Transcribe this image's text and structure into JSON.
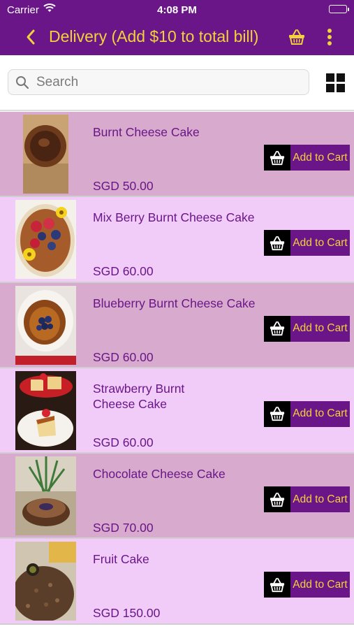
{
  "status_bar": {
    "carrier": "Carrier",
    "time": "4:08 PM"
  },
  "nav": {
    "title": "Delivery (Add $10 to total bill)"
  },
  "search": {
    "placeholder": "Search"
  },
  "products": [
    {
      "name": "Burnt Cheese Cake",
      "price": "SGD 50.00",
      "cart_label": "Add to Cart"
    },
    {
      "name": "Mix Berry Burnt Cheese Cake",
      "price": "SGD 60.00",
      "cart_label": "Add to Cart"
    },
    {
      "name": "Blueberry Burnt Cheese Cake",
      "price": "SGD 60.00",
      "cart_label": "Add to Cart"
    },
    {
      "name": "Strawberry Burnt Cheese Cake",
      "price": "SGD 60.00",
      "cart_label": "Add to Cart"
    },
    {
      "name": "Chocolate Cheese Cake",
      "price": "SGD 70.00",
      "cart_label": "Add to Cart"
    },
    {
      "name": "Fruit Cake",
      "price": "SGD 150.00",
      "cart_label": "Add to Cart"
    }
  ],
  "colors": {
    "header_bg": "#6a1688",
    "title_text": "#f2d13b",
    "row_dark": "#d8aacd",
    "row_light": "#f1ccf9",
    "cart_icon_bg": "#000000"
  },
  "icons": [
    "back-chevron-icon",
    "basket-icon",
    "more-vertical-icon",
    "search-icon",
    "grid-view-icon",
    "cart-basket-icon",
    "wifi-icon",
    "battery-icon"
  ]
}
